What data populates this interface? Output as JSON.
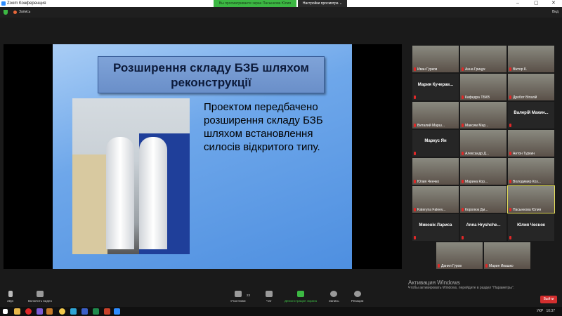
{
  "window": {
    "title": "Zoom Конференция",
    "viewing_banner": "Вы просматриваете экран Пасынкова Юлия",
    "view_options": "Настройки просмотра ⌄",
    "minimize": "–",
    "maximize": "▢",
    "close": "✕"
  },
  "topbar": {
    "record_label": "Запись",
    "view_label": "Вид"
  },
  "slide": {
    "title": "Розширення складу БЗБ шляхом реконструкції",
    "body": "Проектом передбачено розширення складу БЗБ шляхом встановлення силосів відкритого типу."
  },
  "participants": [
    {
      "name": "Иван Гурков",
      "video": true
    },
    {
      "name": "Анна Грицук",
      "video": true
    },
    {
      "name": "Віктор К.",
      "video": true
    },
    {
      "name": "Мария Кучерав...",
      "video": false
    },
    {
      "name": "Кафедра ТБКВ",
      "video": true
    },
    {
      "name": "Дробот Віталій",
      "video": true
    },
    {
      "name": "Виталий Марш...",
      "video": true
    },
    {
      "name": "Максим Мар...",
      "video": true
    },
    {
      "name": "Валерій Макин...",
      "video": false
    },
    {
      "name": "Маркус Ян",
      "video": false
    },
    {
      "name": "Александр Д...",
      "video": true
    },
    {
      "name": "Антон Туркин",
      "video": true
    },
    {
      "name": "Юлия Ченчко",
      "video": true
    },
    {
      "name": "Марина Кор...",
      "video": true
    },
    {
      "name": "Володимир Коз...",
      "video": true
    },
    {
      "name": "Kateryna Faleev...",
      "video": true
    },
    {
      "name": "Королюк Дм...",
      "video": true
    },
    {
      "name": "Пасынкова Юлия",
      "video": true,
      "active": true
    },
    {
      "name": "Миконік Лариса",
      "video": false
    },
    {
      "name": "Anna Hryshche...",
      "video": false
    },
    {
      "name": "Юлия Чеснок",
      "video": false
    },
    {
      "name": "Данил Гуров",
      "video": true
    },
    {
      "name": "Мария Ивашко",
      "video": true
    }
  ],
  "toolbar": {
    "audio": "Звук",
    "video": "Включить видео",
    "participants": "Участники",
    "participants_count": "23",
    "chat": "Чат",
    "share": "Демонстрация экрана",
    "record": "Запись",
    "reactions": "Реакции",
    "leave": "Выйти"
  },
  "activation": {
    "title": "Активация Windows",
    "text": "Чтобы активировать Windows, перейдите в раздел \"Параметры\"."
  },
  "taskbar": {
    "lang": "УКР",
    "time": "10:37"
  }
}
